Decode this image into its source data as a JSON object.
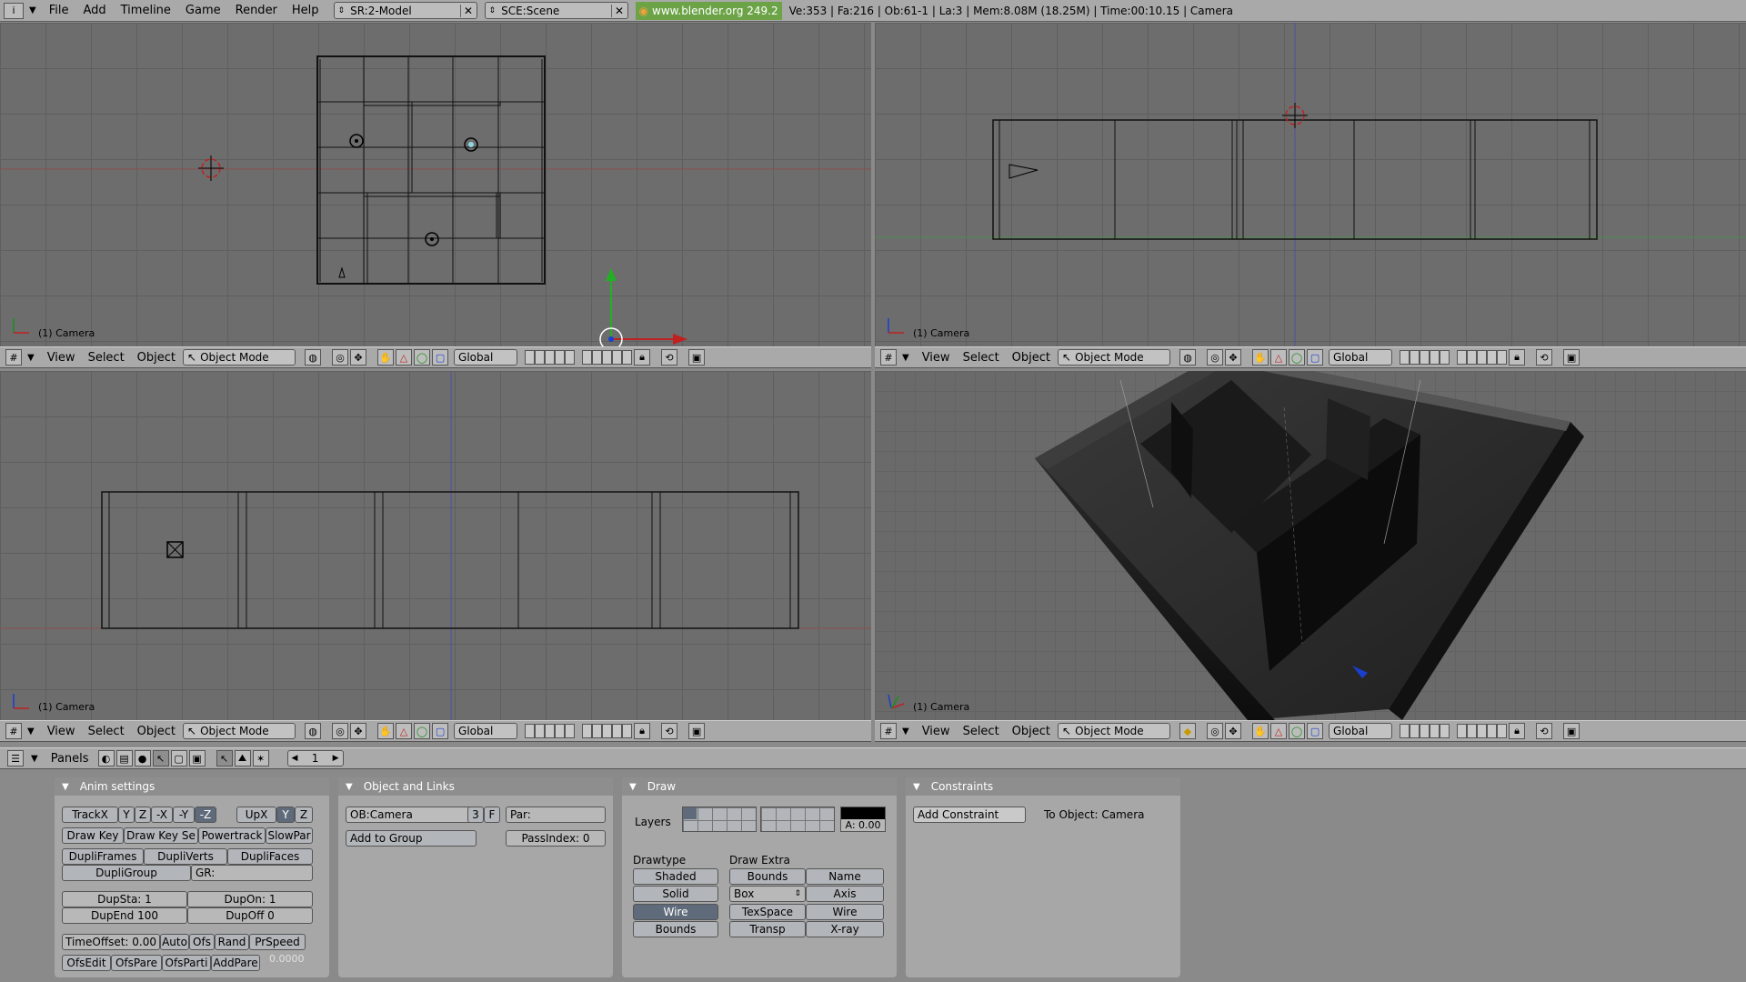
{
  "topbar": {
    "menus": [
      "File",
      "Add",
      "Timeline",
      "Game",
      "Render",
      "Help"
    ],
    "screen_field": "SR:2-Model",
    "scene_field": "SCE:Scene",
    "url": "www.blender.org 249.2",
    "stats": "Ve:353 | Fa:216 | Ob:61-1 | La:3  | Mem:8.08M (18.25M)  | Time:00:10.15 | Camera"
  },
  "viewports": {
    "label": "(1) Camera",
    "header": {
      "view": "View",
      "select": "Select",
      "object": "Object",
      "mode": "Object Mode",
      "orientation": "Global"
    }
  },
  "buttons_header": {
    "panels": "Panels",
    "frame": "1"
  },
  "anim_settings": {
    "title": "Anim settings",
    "trackx": "TrackX",
    "y": "Y",
    "z": "Z",
    "nx": "-X",
    "ny": "-Y",
    "nz": "-Z",
    "upx": "UpX",
    "upy": "Y",
    "upz": "Z",
    "draw_key": "Draw Key",
    "draw_key_sel": "Draw Key Se",
    "powertrack": "Powertrack",
    "slowpar": "SlowPar",
    "dupliframes": "DupliFrames",
    "dupliverts": "DupliVerts",
    "duplifaces": "DupliFaces",
    "dupligroup": "DupliGroup",
    "gr": "GR:",
    "dupsta": "DupSta: 1",
    "dupon": "DupOn: 1",
    "dupend": "DupEnd 100",
    "dupoff": "DupOff 0",
    "timeoffset": "TimeOffset: 0.00",
    "auto": "Auto",
    "ofs": "Ofs",
    "rand": "Rand",
    "prspeed": "PrSpeed",
    "ofsedit": "OfsEdit",
    "ofspare": "OfsPare",
    "ofsparti": "OfsParti",
    "addpare": "AddPare",
    "speed_value": "0.0000"
  },
  "object_links": {
    "title": "Object and Links",
    "ob": "OB:Camera",
    "users": "3",
    "f": "F",
    "par": "Par:",
    "add_group": "Add to Group",
    "passindex": "PassIndex: 0"
  },
  "draw": {
    "title": "Draw",
    "layers": "Layers",
    "alpha": "A: 0.00",
    "drawtype": "Drawtype",
    "draw_extra": "Draw Extra",
    "shaded": "Shaded",
    "solid": "Solid",
    "wire": "Wire",
    "bounds": "Bounds",
    "bounds2": "Bounds",
    "name": "Name",
    "box": "Box",
    "axis": "Axis",
    "texspace": "TexSpace",
    "wire2": "Wire",
    "transp": "Transp",
    "xray": "X-ray"
  },
  "constraints": {
    "title": "Constraints",
    "add": "Add Constraint",
    "to_object": "To Object: Camera"
  }
}
